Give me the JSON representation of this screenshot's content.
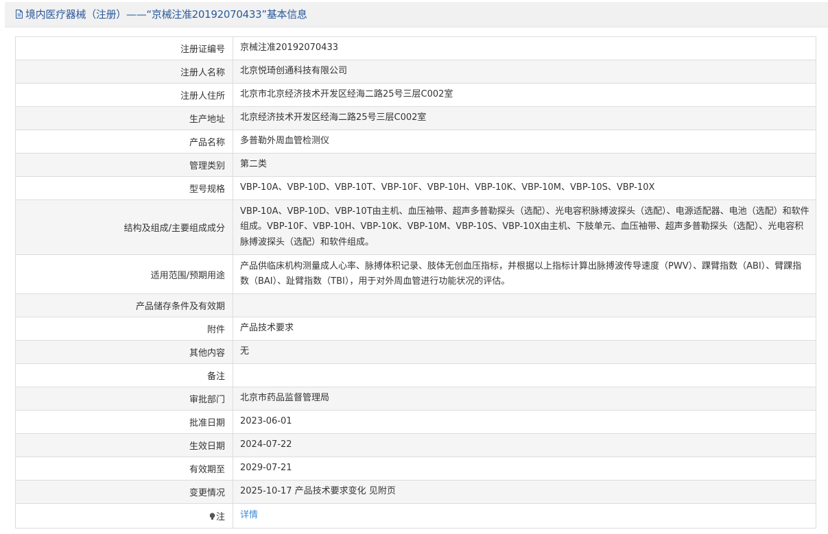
{
  "header": {
    "title": "境内医疗器械（注册）——“京械注准20192070433”基本信息"
  },
  "colors": {
    "title": "#2a5a9c",
    "link": "#3a8ad6",
    "row_alt": "#f5f5f5",
    "border": "#dcdcdc"
  },
  "rows": [
    {
      "label": "注册证编号",
      "value": "京械注准20192070433"
    },
    {
      "label": "注册人名称",
      "value": "北京悦琦创通科技有限公司"
    },
    {
      "label": "注册人住所",
      "value": "北京市北京经济技术开发区经海二路25号三层C002室"
    },
    {
      "label": "生产地址",
      "value": "北京经济技术开发区经海二路25号三层C002室"
    },
    {
      "label": "产品名称",
      "value": "多普勒外周血管检测仪"
    },
    {
      "label": "管理类别",
      "value": "第二类"
    },
    {
      "label": "型号规格",
      "value": "VBP-10A、VBP-10D、VBP-10T、VBP-10F、VBP-10H、VBP-10K、VBP-10M、VBP-10S、VBP-10X"
    },
    {
      "label": "结构及组成/主要组成成分",
      "value": "VBP-10A、VBP-10D、VBP-10T由主机、血压袖带、超声多普勒探头（选配）、光电容积脉搏波探头（选配）、电源适配器、电池（选配）和软件组成。VBP-10F、VBP-10H、VBP-10K、VBP-10M、VBP-10S、VBP-10X由主机、下肢单元、血压袖带、超声多普勒探头（选配）、光电容积脉搏波探头（选配）和软件组成。"
    },
    {
      "label": "适用范围/预期用途",
      "value": "产品供临床机构测量成人心率、脉搏体积记录、肢体无创血压指标，并根据以上指标计算出脉搏波传导速度（PWV）、踝臂指数（ABI）、臂踝指数（BAI）、趾臂指数（TBI），用于对外周血管进行功能状况的评估。"
    },
    {
      "label": "产品储存条件及有效期",
      "value": ""
    },
    {
      "label": "附件",
      "value": "产品技术要求"
    },
    {
      "label": "其他内容",
      "value": "无"
    },
    {
      "label": "备注",
      "value": ""
    },
    {
      "label": "审批部门",
      "value": "北京市药品监督管理局"
    },
    {
      "label": "批准日期",
      "value": "2023-06-01"
    },
    {
      "label": "生效日期",
      "value": "2024-07-22"
    },
    {
      "label": "有效期至",
      "value": "2029-07-21"
    },
    {
      "label": "变更情况",
      "value": "2025-10-17 产品技术要求变化 见附页"
    },
    {
      "label": "注",
      "value": "详情"
    }
  ]
}
